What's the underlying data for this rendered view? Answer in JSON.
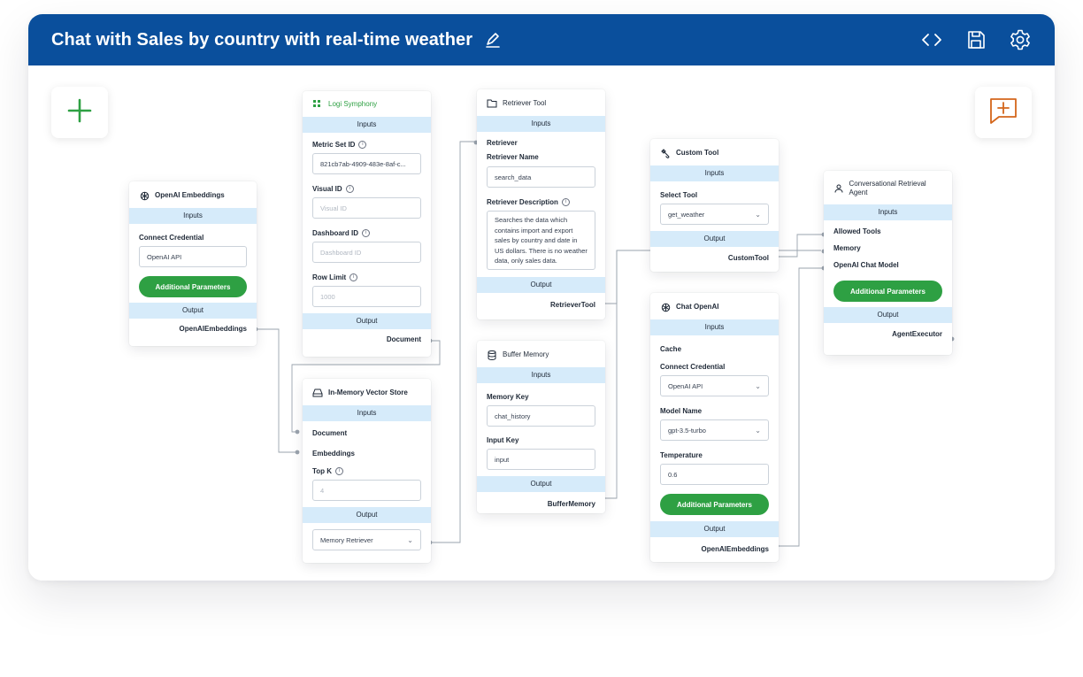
{
  "header": {
    "title": "Chat with Sales by country with real-time weather"
  },
  "colors": {
    "header": "#0a4f9c",
    "accent_green": "#2ea043",
    "band": "#d6ebfa",
    "chat_icon": "#d4661b"
  },
  "icons": [
    "pencil-icon",
    "code-icon",
    "save-icon",
    "gear-icon",
    "plus-icon",
    "chat-plus-icon"
  ],
  "common": {
    "inputs": "Inputs",
    "output": "Output"
  },
  "openai_embeddings": {
    "title": "OpenAI Embeddings",
    "credential_label": "Connect Credential",
    "credential_value": "OpenAI API",
    "button": "Additional Parameters",
    "output_name": "OpenAIEmbeddings"
  },
  "logi": {
    "title": "Logi Symphony",
    "metric_label": "Metric Set ID",
    "metric_value": "821cb7ab-4909-483e-8af-c...",
    "visual_label": "Visual ID",
    "visual_placeholder": "Visual ID",
    "dashboard_label": "Dashboard ID",
    "dashboard_placeholder": "Dashboard ID",
    "row_label": "Row Limit",
    "row_placeholder": "1000",
    "output_name": "Document"
  },
  "vector_store": {
    "title": "In-Memory Vector Store",
    "in_document": "Document",
    "in_embeddings": "Embeddings",
    "topk_label": "Top K",
    "topk_placeholder": "4",
    "output_select": "Memory Retriever"
  },
  "retriever_tool": {
    "title": "Retriever Tool",
    "in_retriever": "Retriever",
    "name_label": "Retriever Name",
    "name_value": "search_data",
    "desc_label": "Retriever Description",
    "desc_value": "Searches the data which contains import and export sales by country and date in US dollars. There is no weather data, only sales data.",
    "output_name": "RetrieverTool"
  },
  "buffer_memory": {
    "title": "Buffer Memory",
    "key_label": "Memory Key",
    "key_value": "chat_history",
    "input_label": "Input Key",
    "input_value": "input",
    "output_name": "BufferMemory"
  },
  "custom_tool": {
    "title": "Custom Tool",
    "select_label": "Select Tool",
    "select_value": "get_weather",
    "output_name": "CustomTool"
  },
  "chat_openai": {
    "title": "Chat OpenAI",
    "cache_label": "Cache",
    "credential_label": "Connect Credential",
    "credential_value": "OpenAI API",
    "model_label": "Model Name",
    "model_value": "gpt-3.5-turbo",
    "temp_label": "Temperature",
    "temp_value": "0.6",
    "button": "Additional Parameters",
    "output_name": "OpenAIEmbeddings"
  },
  "agent": {
    "title": "Conversational Retrieval Agent",
    "in_tools": "Allowed Tools",
    "in_memory": "Memory",
    "in_model": "OpenAI Chat Model",
    "button": "Additional Parameters",
    "output_name": "AgentExecutor"
  }
}
